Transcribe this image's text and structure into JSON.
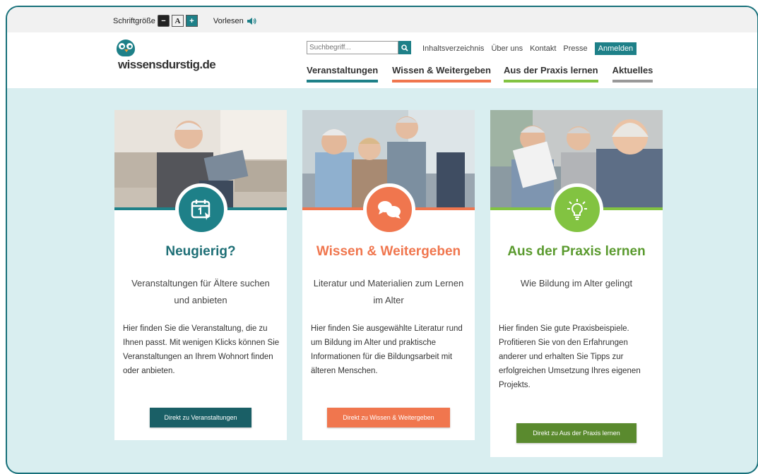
{
  "toolbar": {
    "font_size_label": "Schriftgröße",
    "font_decrease": "−",
    "font_reset": "A",
    "font_increase": "+",
    "read_aloud_label": "Vorlesen",
    "read_aloud_icon": "speaker-icon"
  },
  "header": {
    "logo_text": "wissensdurstig.de",
    "search_placeholder": "Suchbegriff...",
    "search_icon": "search-icon",
    "top_links": [
      "Inhaltsverzeichnis",
      "Über uns",
      "Kontakt",
      "Presse"
    ],
    "login_label": "Anmelden",
    "nav": [
      "Veranstaltungen",
      "Wissen & Weitergeben",
      "Aus der Praxis lernen",
      "Aktuelles"
    ]
  },
  "colors": {
    "teal": "#1e8088",
    "orange": "#f0764e",
    "green": "#82c341",
    "background": "#d9eef0"
  },
  "cards": [
    {
      "icon": "calendar-click-icon",
      "title": "Neugierig?",
      "subtitle": "Veranstaltungen für Ältere suchen und anbieten",
      "description": "Hier finden Sie die Veranstaltung, die zu Ihnen passt. Mit wenigen Klicks können Sie Veranstaltungen an Ihrem Wohnort finden oder anbieten.",
      "button": "Direkt zu Veranstaltungen"
    },
    {
      "icon": "speech-bubbles-icon",
      "title": "Wissen & Weitergeben",
      "subtitle": "Literatur und Materialien zum Lernen im Alter",
      "description": "Hier finden Sie ausgewählte Literatur rund um Bildung im Alter und praktische Informationen für die Bildungsarbeit mit älteren Menschen.",
      "button": "Direkt zu Wissen & Weitergeben"
    },
    {
      "icon": "lightbulb-icon",
      "title": "Aus der Praxis lernen",
      "subtitle": "Wie Bildung im Alter gelingt",
      "description": "Hier finden Sie gute Praxisbeispiele. Profitieren Sie von den Erfahrungen anderer und erhalten Sie Tipps zur erfolgreichen Umsetzung Ihres eigenen Projekts.",
      "button": "Direkt zu Aus der Praxis lernen"
    }
  ]
}
